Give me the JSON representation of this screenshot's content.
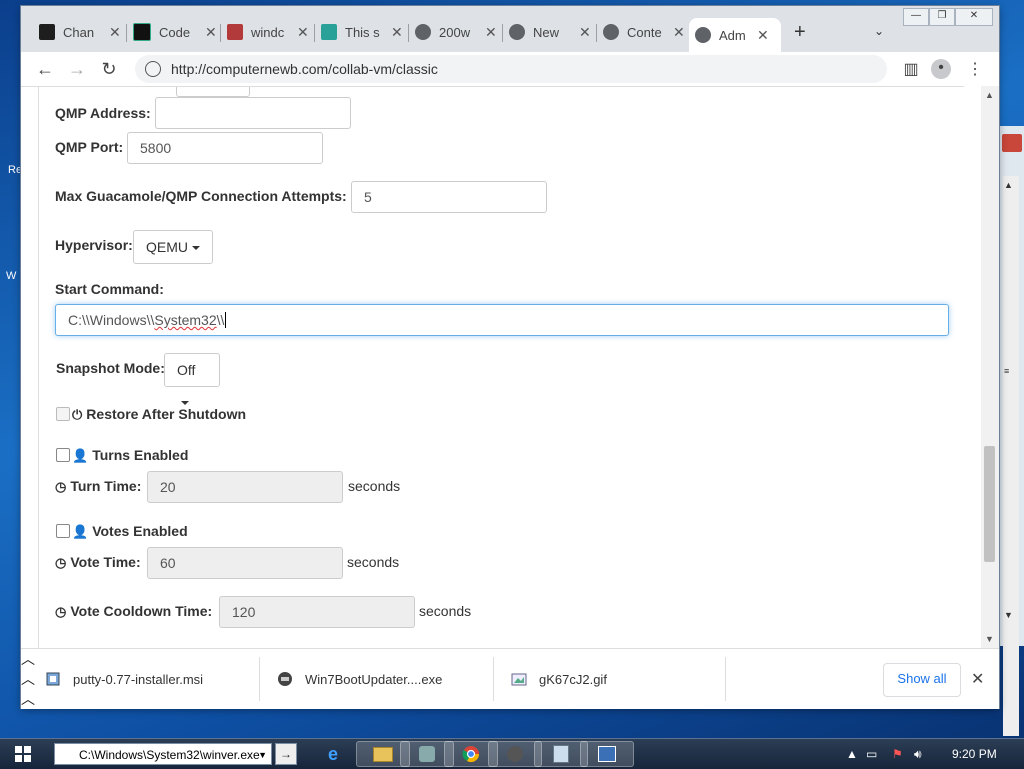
{
  "tabs": [
    {
      "label": "Chan",
      "icon": "stackexchange-icon",
      "color": "#1e1e1e"
    },
    {
      "label": "Code",
      "icon": "code-icon",
      "color": "#111111"
    },
    {
      "label": "windc",
      "icon": "bookmark-icon",
      "color": "#b33a3a"
    },
    {
      "label": "This s",
      "icon": "translate-icon",
      "color": "#2aa198"
    },
    {
      "label": "200w",
      "icon": "globe-icon",
      "color": "#5f6368"
    },
    {
      "label": "New",
      "icon": "chrome-icon",
      "color": "#5f6368"
    },
    {
      "label": "Conte",
      "icon": "globe-icon",
      "color": "#5f6368"
    },
    {
      "label": "Adm",
      "icon": "globe-icon",
      "color": "#5f6368"
    }
  ],
  "address": {
    "url": "http://computernewb.com/collab-vm/classic"
  },
  "form": {
    "qmp_address_label": "QMP Address:",
    "qmp_address_value": "",
    "qmp_port_label": "QMP Port:",
    "qmp_port_value": "5800",
    "max_attempts_label": "Max Guacamole/QMP Connection Attempts:",
    "max_attempts_value": "5",
    "hypervisor_label": "Hypervisor:",
    "hypervisor_value": "QEMU",
    "start_command_label": "Start Command:",
    "start_command_prefix": "C:\\\\Windows\\\\",
    "start_command_misspelled": "System32",
    "start_command_suffix": "\\\\",
    "snapshot_label": "Snapshot Mode:",
    "snapshot_value": "Off",
    "restore_label": "Restore After Shutdown",
    "turns_enabled_label": "Turns Enabled",
    "turn_time_label": "Turn Time:",
    "turn_time_value": "20",
    "votes_enabled_label": "Votes Enabled",
    "vote_time_label": "Vote Time:",
    "vote_time_value": "60",
    "vote_cooldown_label": "Vote Cooldown Time:",
    "vote_cooldown_value": "120",
    "seconds": "seconds"
  },
  "downloads": {
    "items": [
      {
        "name": "putty-0.77-installer.msi",
        "icon": "msi-installer-icon"
      },
      {
        "name": "Win7BootUpdater....exe",
        "icon": "exe-app-icon"
      },
      {
        "name": "gK67cJ2.gif",
        "icon": "image-file-icon"
      }
    ],
    "show_all": "Show all"
  },
  "taskbar": {
    "run_value": "C:\\Windows\\System32\\winver.exe",
    "clock": "9:20 PM"
  },
  "colors": {
    "accent": "#66afe9",
    "link": "#1a73e8",
    "tabbar": "#dee1e6"
  }
}
